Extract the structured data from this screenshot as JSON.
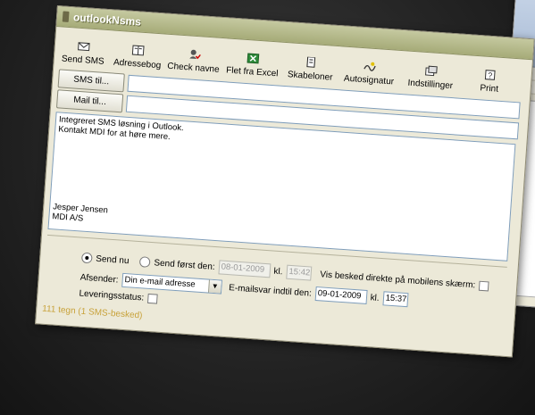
{
  "window": {
    "title": "outlookNsms"
  },
  "toolbar": {
    "items": [
      {
        "label": "Send SMS",
        "icon": "send-sms-icon"
      },
      {
        "label": "Adressebog",
        "icon": "address-book-icon"
      },
      {
        "label": "Check navne",
        "icon": "check-names-icon"
      },
      {
        "label": "Flet fra Excel",
        "icon": "excel-icon"
      },
      {
        "label": "Skabeloner",
        "icon": "templates-icon"
      },
      {
        "label": "Autosignatur",
        "icon": "signature-icon"
      },
      {
        "label": "Indstillinger",
        "icon": "settings-icon"
      },
      {
        "label": "Print",
        "icon": "help-print-icon"
      }
    ]
  },
  "address": {
    "sms_button": "SMS til...",
    "mail_button": "Mail til...",
    "sms_value": "",
    "mail_value": ""
  },
  "message": {
    "line1": "Integreret SMS løsning i Outlook.",
    "line2": "Kontakt MDI for at høre mere.",
    "sig1": "Jesper Jensen",
    "sig2": "MDI A/S"
  },
  "options": {
    "send_now": "Send nu",
    "send_first": "Send først den:",
    "send_first_date": "08-01-2009",
    "kl1": "kl.",
    "send_first_time": "15:42",
    "show_on_screen": "Vis besked direkte på mobilens skærm:",
    "sender_label": "Afsender:",
    "sender_value": "Din e-mail adresse",
    "reply_label": "E-mailsvar indtil den:",
    "reply_date": "09-01-2009",
    "kl2": "kl.",
    "reply_time": "15:37",
    "delivery_label": "Leveringsstatus:"
  },
  "status": {
    "text": "111 tegn (1 SMS-besked)"
  },
  "colors": {
    "window_bg": "#ece9d8",
    "title_bar": "#a6ab78",
    "status_text": "#c8a23a"
  }
}
